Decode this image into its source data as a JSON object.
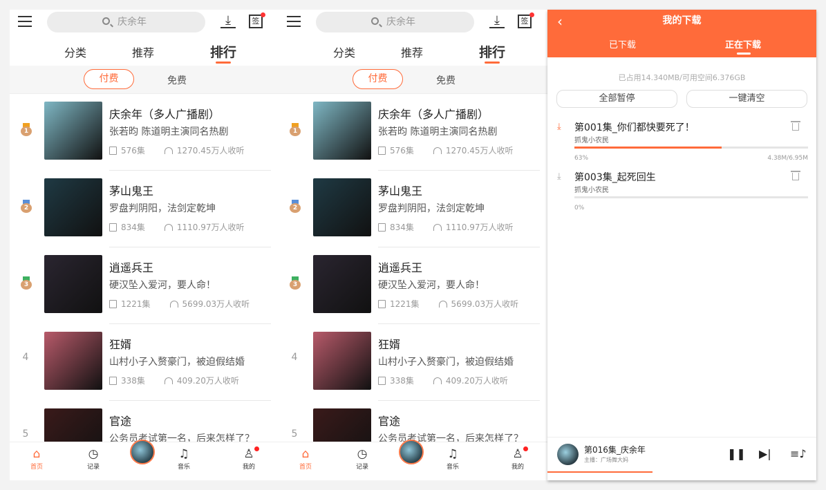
{
  "home": {
    "search_placeholder": "庆余年",
    "tabs": [
      "分类",
      "推荐",
      "排行"
    ],
    "active_tab": 2,
    "filters": [
      "付费",
      "免费"
    ],
    "ranking": [
      {
        "rank": "1",
        "title": "庆余年（多人广播剧）",
        "subtitle": "张若昀 陈道明主演同名热剧",
        "episodes": "576集",
        "listeners": "1270.45万人收听",
        "cover_color": "#7fb7c4"
      },
      {
        "rank": "2",
        "title": "茅山鬼王",
        "subtitle": "罗盘判阴阳，法剑定乾坤",
        "episodes": "834集",
        "listeners": "1110.97万人收听",
        "cover_color": "#1f3a44"
      },
      {
        "rank": "3",
        "title": "逍遥兵王",
        "subtitle": "硬汉坠入爱河，要人命！",
        "episodes": "1221集",
        "listeners": "5699.03万人收听",
        "cover_color": "#2a2530"
      },
      {
        "rank": "4",
        "title": "狂婿",
        "subtitle": "山村小子入赘豪门，被迫假结婚",
        "episodes": "338集",
        "listeners": "409.20万人收听",
        "cover_color": "#b85a6a"
      },
      {
        "rank": "5",
        "title": "官途",
        "subtitle": "公务员考试第一名，后来怎样了？",
        "episodes": "",
        "listeners": "",
        "cover_color": "#3a1a1a"
      }
    ],
    "medal_colors": [
      "#f0a020",
      "#5a8fd8",
      "#3db060"
    ],
    "nav": [
      {
        "label": "首页",
        "icon": "home-icon",
        "glyph": "⌂"
      },
      {
        "label": "记录",
        "icon": "clock-icon",
        "glyph": "◷"
      },
      {
        "label": "",
        "icon": "now-playing-disc",
        "glyph": ""
      },
      {
        "label": "音乐",
        "icon": "music-note-icon",
        "glyph": "♫"
      },
      {
        "label": "我的",
        "icon": "user-icon",
        "glyph": "♙"
      }
    ],
    "accent": "#ff6b3a"
  },
  "downloads": {
    "title": "我的下载",
    "tabs": [
      "已下载",
      "正在下载"
    ],
    "active_tab": 1,
    "storage": "已占用14.340MB/可用空间6.376GB",
    "pause_all": "全部暂停",
    "clear_all": "一键清空",
    "items": [
      {
        "name": "第001集_你们都快要死了！",
        "author": "抓鬼小农民",
        "progress": "63%",
        "progress_value": 63,
        "size": "4.38M/6.95M",
        "active": true
      },
      {
        "name": "第003集_起死回生",
        "author": "抓鬼小农民",
        "progress": "0%",
        "progress_value": 0,
        "size": "",
        "active": false
      }
    ],
    "player": {
      "title": "第016集_庆余年",
      "host": "主播：广场舞大妈",
      "progress_fraction": 0.39
    }
  }
}
